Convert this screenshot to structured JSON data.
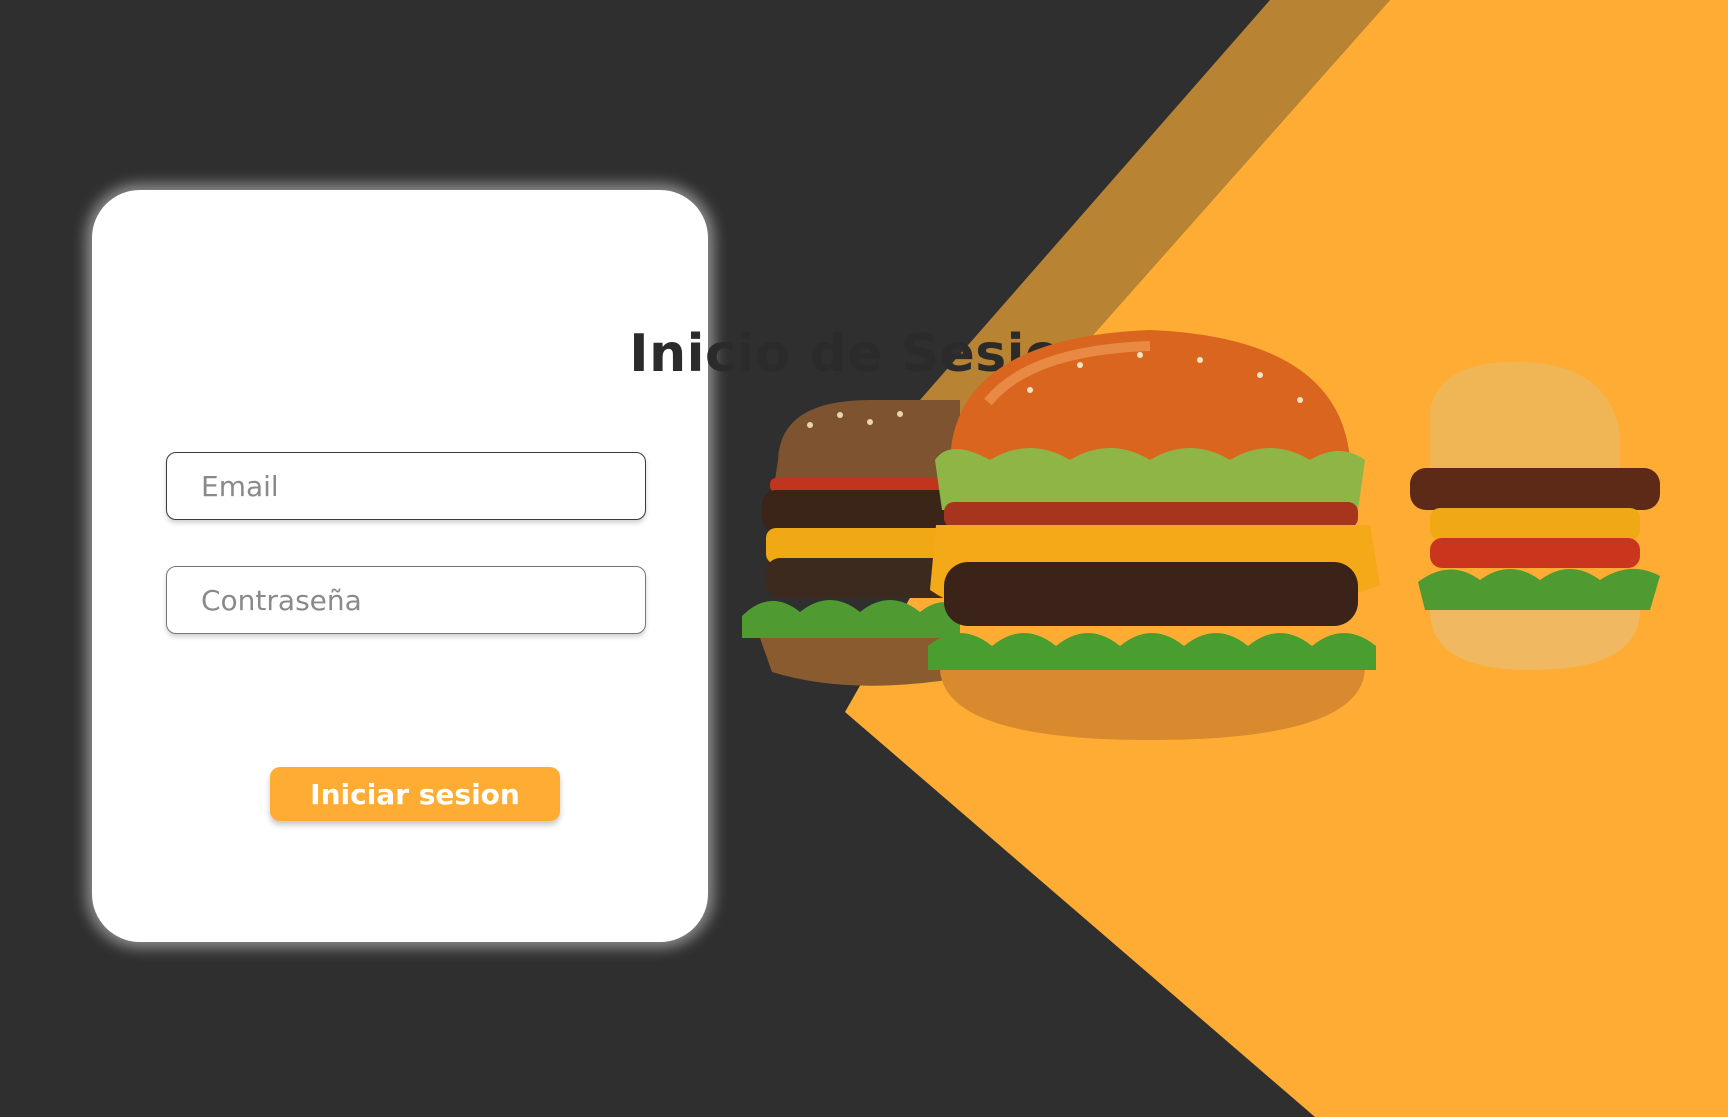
{
  "login": {
    "title": "Inicio de Sesion",
    "email_placeholder": "Email",
    "password_placeholder": "Contraseña",
    "submit_label": "Iniciar sesion"
  },
  "hero": {
    "image": "burger-trio-illustration"
  },
  "colors": {
    "background": "#2f2f2f",
    "accent": "#ffac35",
    "accent_dark": "#b88434",
    "card": "#ffffff",
    "title_text": "#2b2b2b"
  }
}
